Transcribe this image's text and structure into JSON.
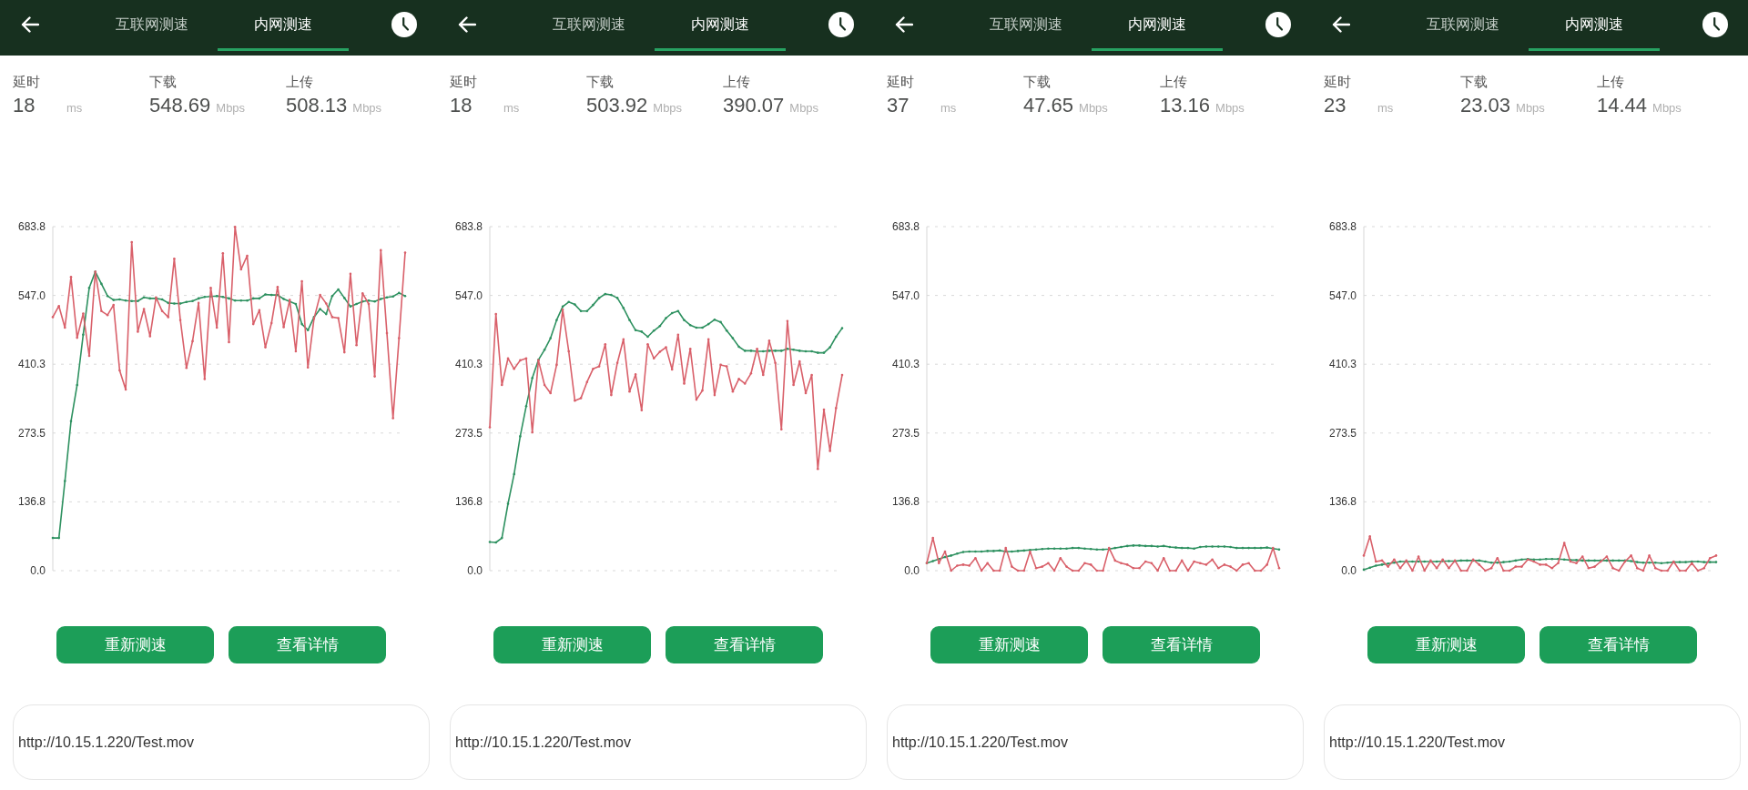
{
  "panels": [
    {
      "tabs": [
        {
          "label": "互联网测速",
          "selected": false
        },
        {
          "label": "内网测速",
          "selected": true
        }
      ],
      "stats": [
        {
          "label": "延时",
          "value": "18",
          "unit": "ms"
        },
        {
          "label": "下载",
          "value": "548.69",
          "unit": "Mbps"
        },
        {
          "label": "上传",
          "value": "508.13",
          "unit": "Mbps"
        }
      ],
      "chart_data": {
        "type": "line",
        "grid": true,
        "ylim": [
          0,
          683.8
        ],
        "yticks": [
          {
            "value": 0,
            "label": "0.0"
          },
          {
            "value": 136.8,
            "label": "136.8"
          },
          {
            "value": 273.5,
            "label": "273.5"
          },
          {
            "value": 410.3,
            "label": "410.3"
          },
          {
            "value": 547,
            "label": "547.0"
          },
          {
            "value": 683.8,
            "label": "683.8"
          }
        ],
        "series": [
          {
            "color": "#2e9160",
            "values": [
              65,
              65,
              178,
              297,
              369,
              469,
              562,
              594,
              570,
              546,
              538,
              539,
              537,
              536,
              536,
              543,
              541,
              541,
              539,
              532,
              531,
              531,
              534,
              536,
              541,
              544,
              545,
              546,
              544,
              541,
              537,
              537,
              537,
              541,
              541,
              549,
              548,
              548,
              540,
              535,
              530,
              490,
              478,
              504,
              520,
              510,
              546,
              559,
              542,
              525,
              530,
              535,
              537,
              535,
              540,
              543,
              545,
              552,
              546
            ]
          },
          {
            "color": "#d9606a",
            "values": [
              504,
              526,
              483,
              584,
              463,
              511,
              427,
              594,
              516,
              508,
              528,
              398,
              360,
              653,
              475,
              520,
              466,
              543,
              516,
              504,
              620,
              498,
              403,
              456,
              532,
              381,
              562,
              483,
              631,
              454,
              683,
              599,
              626,
              490,
              518,
              444,
              492,
              564,
              484,
              538,
              436,
              575,
              404,
              501,
              548,
              531,
              504,
              502,
              434,
              590,
              448,
              551,
              530,
              386,
              637,
              472,
              303,
              462,
              632
            ]
          }
        ]
      },
      "buttons": [
        "重新测速",
        "查看详情"
      ],
      "url_field": {
        "value": "http://10.15.1.220/Test.mov"
      }
    },
    {
      "tabs": [
        {
          "label": "互联网测速",
          "selected": false
        },
        {
          "label": "内网测速",
          "selected": true
        }
      ],
      "stats": [
        {
          "label": "延时",
          "value": "18",
          "unit": "ms"
        },
        {
          "label": "下载",
          "value": "503.92",
          "unit": "Mbps"
        },
        {
          "label": "上传",
          "value": "390.07",
          "unit": "Mbps"
        }
      ],
      "chart_data": {
        "type": "line",
        "grid": true,
        "ylim": [
          0,
          683.8
        ],
        "yticks": [
          {
            "value": 0,
            "label": "0.0"
          },
          {
            "value": 136.8,
            "label": "136.8"
          },
          {
            "value": 273.5,
            "label": "273.5"
          },
          {
            "value": 410.3,
            "label": "410.3"
          },
          {
            "value": 547,
            "label": "547.0"
          },
          {
            "value": 683.8,
            "label": "683.8"
          }
        ],
        "series": [
          {
            "color": "#2e9160",
            "values": [
              57,
              56,
              65,
              133,
              192,
              267,
              327,
              383,
              419,
              439,
              462,
              498,
              525,
              534,
              529,
              516,
              516,
              528,
              542,
              550,
              548,
              542,
              522,
              498,
              478,
              475,
              465,
              477,
              486,
              502,
              512,
              516,
              498,
              488,
              483,
              483,
              490,
              499,
              494,
              477,
              462,
              445,
              437,
              437,
              436,
              436,
              437,
              437,
              437,
              441,
              439,
              437,
              436,
              436,
              433,
              433,
              444,
              465,
              482
            ]
          },
          {
            "color": "#d9606a",
            "values": [
              285,
              510,
              369,
              422,
              401,
              418,
              422,
              275,
              418,
              369,
              353,
              409,
              519,
              436,
              338,
              343,
              375,
              401,
              406,
              450,
              349,
              413,
              460,
              356,
              390,
              319,
              450,
              422,
              435,
              444,
              400,
              469,
              372,
              441,
              340,
              358,
              460,
              349,
              409,
              406,
              356,
              381,
              372,
              392,
              441,
              389,
              457,
              413,
              281,
              496,
              369,
              416,
              353,
              389,
              202,
              320,
              238,
              323,
              389
            ]
          }
        ]
      },
      "buttons": [
        "重新测速",
        "查看详情"
      ],
      "url_field": {
        "value": "http://10.15.1.220/Test.mov"
      }
    },
    {
      "tabs": [
        {
          "label": "互联网测速",
          "selected": false
        },
        {
          "label": "内网测速",
          "selected": true
        }
      ],
      "stats": [
        {
          "label": "延时",
          "value": "37",
          "unit": "ms"
        },
        {
          "label": "下载",
          "value": "47.65",
          "unit": "Mbps"
        },
        {
          "label": "上传",
          "value": "13.16",
          "unit": "Mbps"
        }
      ],
      "chart_data": {
        "type": "line",
        "grid": true,
        "ylim": [
          0,
          683.8
        ],
        "yticks": [
          {
            "value": 0,
            "label": "0.0"
          },
          {
            "value": 136.8,
            "label": "136.8"
          },
          {
            "value": 273.5,
            "label": "273.5"
          },
          {
            "value": 410.3,
            "label": "410.3"
          },
          {
            "value": 547,
            "label": "547.0"
          },
          {
            "value": 683.8,
            "label": "683.8"
          }
        ],
        "series": [
          {
            "color": "#2e9160",
            "values": [
              15,
              19,
              23,
              27,
              30,
              34,
              37,
              38,
              38,
              38,
              39,
              39,
              40,
              38,
              38,
              39,
              40,
              41,
              42,
              43,
              44,
              44,
              44,
              44,
              45,
              45,
              44,
              43,
              42,
              42,
              43,
              45,
              47,
              49,
              50,
              50,
              49,
              49,
              48,
              49,
              47,
              46,
              45,
              45,
              44,
              47,
              48,
              48,
              48,
              48,
              47,
              45,
              45,
              45,
              45,
              45,
              46,
              44,
              42
            ]
          },
          {
            "color": "#d9606a",
            "values": [
              15,
              65,
              15,
              38,
              0,
              10,
              12,
              10,
              25,
              0,
              15,
              0,
              0,
              45,
              8,
              0,
              0,
              38,
              5,
              8,
              15,
              0,
              25,
              8,
              0,
              0,
              15,
              12,
              0,
              0,
              45,
              20,
              15,
              12,
              5,
              5,
              18,
              15,
              0,
              25,
              0,
              0,
              20,
              0,
              18,
              15,
              12,
              22,
              5,
              12,
              8,
              0,
              12,
              15,
              0,
              0,
              12,
              45,
              5
            ]
          }
        ]
      },
      "buttons": [
        "重新测速",
        "查看详情"
      ],
      "url_field": {
        "value": "http://10.15.1.220/Test.mov"
      }
    },
    {
      "tabs": [
        {
          "label": "互联网测速",
          "selected": false
        },
        {
          "label": "内网测速",
          "selected": true
        }
      ],
      "stats": [
        {
          "label": "延时",
          "value": "23",
          "unit": "ms"
        },
        {
          "label": "下载",
          "value": "23.03",
          "unit": "Mbps"
        },
        {
          "label": "上传",
          "value": "14.44",
          "unit": "Mbps"
        }
      ],
      "chart_data": {
        "type": "line",
        "grid": true,
        "ylim": [
          0,
          683.8
        ],
        "yticks": [
          {
            "value": 0,
            "label": "0.0"
          },
          {
            "value": 136.8,
            "label": "136.8"
          },
          {
            "value": 273.5,
            "label": "273.5"
          },
          {
            "value": 410.3,
            "label": "410.3"
          },
          {
            "value": 547,
            "label": "547.0"
          },
          {
            "value": 683.8,
            "label": "683.8"
          }
        ],
        "series": [
          {
            "color": "#2e9160",
            "values": [
              2,
              6,
              10,
              12,
              14,
              16,
              18,
              18,
              18,
              18,
              18,
              18,
              18,
              19,
              19,
              19,
              20,
              20,
              20,
              20,
              18,
              16,
              16,
              17,
              18,
              20,
              22,
              23,
              22,
              22,
              23,
              23,
              23,
              22,
              21,
              21,
              20,
              20,
              20,
              20,
              20,
              20,
              20,
              20,
              19,
              17,
              16,
              16,
              16,
              15,
              16,
              17,
              17,
              17,
              18,
              18,
              17,
              17,
              17
            ]
          },
          {
            "color": "#d9606a",
            "values": [
              30,
              68,
              18,
              20,
              8,
              22,
              5,
              20,
              0,
              28,
              0,
              20,
              5,
              22,
              5,
              20,
              0,
              0,
              22,
              12,
              0,
              5,
              25,
              0,
              0,
              8,
              8,
              22,
              18,
              12,
              12,
              5,
              15,
              55,
              18,
              15,
              28,
              5,
              8,
              18,
              28,
              5,
              0,
              18,
              30,
              5,
              0,
              30,
              5,
              0,
              0,
              18,
              0,
              0,
              15,
              0,
              5,
              25,
              30
            ]
          }
        ]
      },
      "buttons": [
        "重新测速",
        "查看详情"
      ],
      "url_field": {
        "value": "http://10.15.1.220/Test.mov"
      }
    }
  ]
}
